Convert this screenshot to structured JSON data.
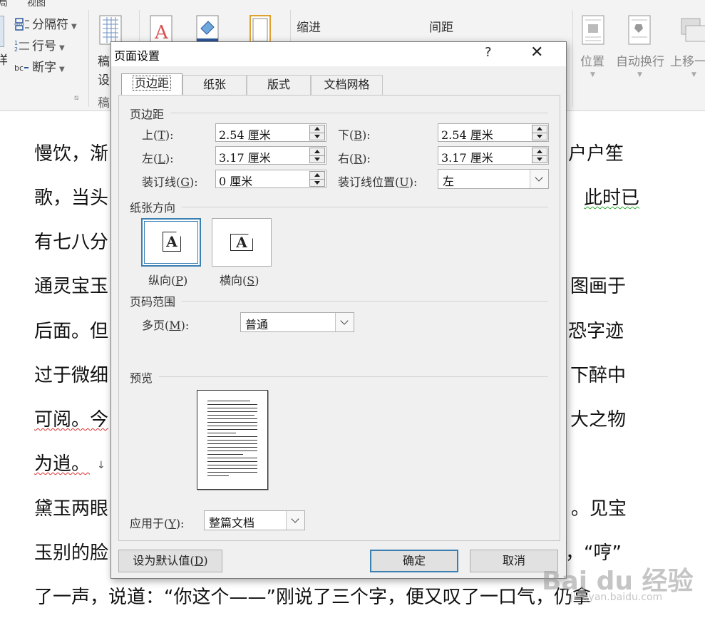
{
  "ribbon": {
    "menu_view": "视图",
    "menu_left": "局",
    "separator": "分隔符",
    "line_numbers": "行号",
    "hyphenation": "断字",
    "left_clip": "样",
    "manuscript_line1": "稿",
    "manuscript_line2": "设",
    "manuscript_group": "稿",
    "indent": "缩进",
    "spacing": "间距",
    "position": "位置",
    "wrap_text": "自动换行",
    "bring_forward": "上移一"
  },
  "document": {
    "lines": [
      {
        "left": "慢饮，渐",
        "right": "户户笙"
      },
      {
        "left": "歌，当头",
        "right": "此时已"
      },
      {
        "left": "有七八分",
        "right": ""
      },
      {
        "left": "通灵宝玉",
        "right": "图画于"
      },
      {
        "left": "后面。但",
        "right": "恐字迹"
      },
      {
        "left": "过于微细",
        "right": "下醉中"
      },
      {
        "left": "可阅。今",
        "right": "大之物"
      },
      {
        "left": "为逍。",
        "right": ""
      },
      {
        "left": "黛玉两眼",
        "right": "。见宝"
      },
      {
        "left": "玉别的脸",
        "right": "，“哼”"
      },
      {
        "left": "了一声，说道：“你这个——”刚说了三个字，便又叹了一口气，仍拿",
        "right": ""
      }
    ]
  },
  "dialog": {
    "title": "页面设置",
    "help": "?",
    "close": "✕",
    "tabs": [
      "页边距",
      "纸张",
      "版式",
      "文档网格"
    ],
    "margins": {
      "group_title": "页边距",
      "top_label": "上(",
      "top_key": "T",
      "top_value": "2.54 厘米",
      "bottom_label": "下(",
      "bottom_key": "B",
      "bottom_value": "2.54 厘米",
      "left_label": "左(",
      "left_key": "L",
      "left_value": "3.17 厘米",
      "right_label": "右(",
      "right_key": "R",
      "right_value": "3.17 厘米",
      "gutter_label": "装订线(",
      "gutter_key": "G",
      "gutter_value": "0 厘米",
      "gutter_pos_label": "装订线位置(",
      "gutter_pos_key": "U",
      "gutter_pos_value": "左",
      "suffix": "):"
    },
    "orientation": {
      "group_title": "纸张方向",
      "portrait": "纵向(",
      "portrait_key": "P",
      "landscape": "横向(",
      "landscape_key": "S",
      "close_paren": ")",
      "glyph": "A"
    },
    "pages": {
      "group_title": "页码范围",
      "multi_label": "多页(",
      "multi_key": "M",
      "multi_value": "普通"
    },
    "preview": {
      "group_title": "预览",
      "apply_label": "应用于(",
      "apply_key": "Y",
      "apply_value": "整篇文档"
    },
    "buttons": {
      "set_default": "设为默认值(",
      "set_default_key": "D",
      "ok": "确定",
      "cancel": "取消"
    }
  },
  "watermark": {
    "text": "Bai du 经验",
    "url": "jingyan.baidu.com"
  }
}
